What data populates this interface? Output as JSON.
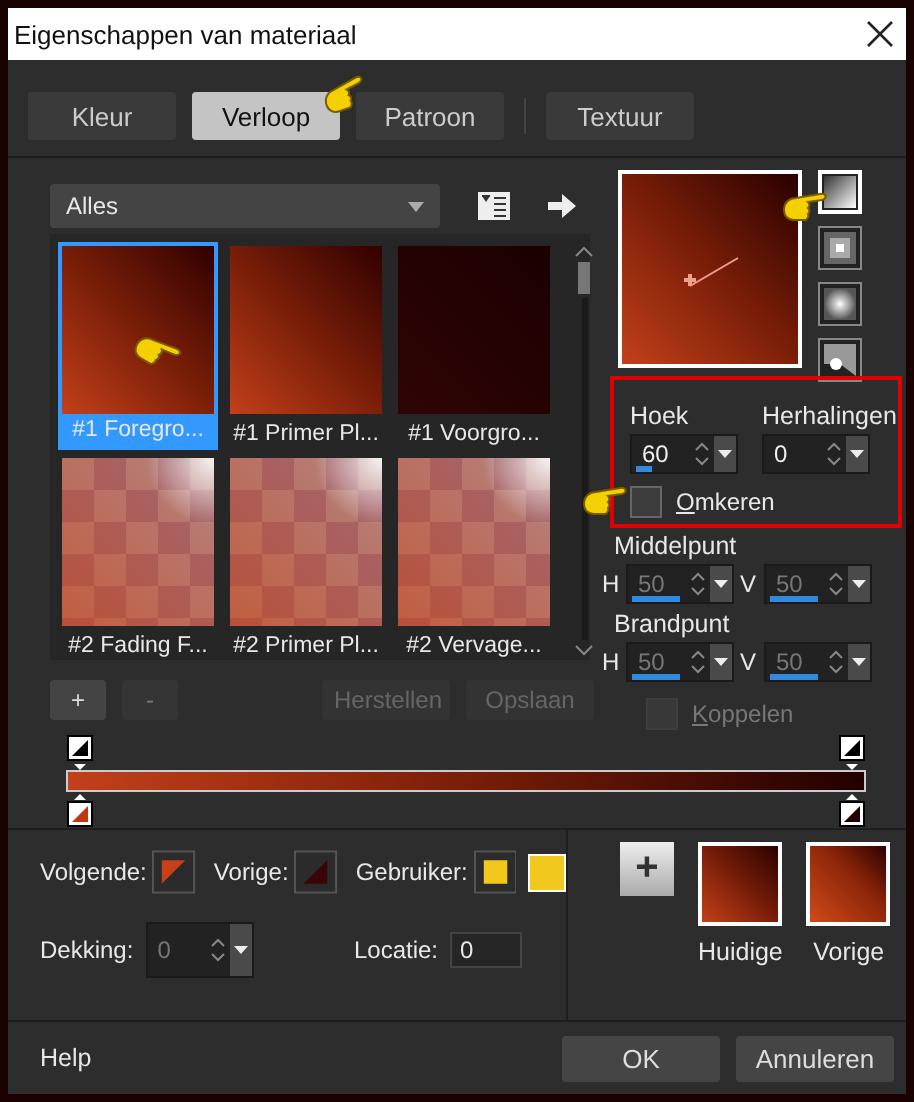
{
  "window": {
    "title": "Eigenschappen van materiaal"
  },
  "tabs": [
    {
      "label": "Kleur",
      "selected": false
    },
    {
      "label": "Verloop",
      "selected": true
    },
    {
      "label": "Patroon",
      "selected": false
    },
    {
      "label": "Textuur",
      "selected": false
    }
  ],
  "category": {
    "value": "Alles"
  },
  "gradients": [
    {
      "label": "#1 Foregro...",
      "kind": "warm",
      "selected": true
    },
    {
      "label": "#1 Primer Pl...",
      "kind": "warm",
      "selected": false
    },
    {
      "label": "#1 Voorgro...",
      "kind": "dark",
      "selected": false
    },
    {
      "label": "#2 Fading F...",
      "kind": "checker",
      "selected": false
    },
    {
      "label": "#2 Primer Pl...",
      "kind": "checker",
      "selected": false
    },
    {
      "label": "#2 Vervage...",
      "kind": "checker",
      "selected": false
    }
  ],
  "styles": [
    {
      "kind": "linear",
      "selected": true
    },
    {
      "kind": "rectangular",
      "selected": false
    },
    {
      "kind": "sunburst",
      "selected": false
    },
    {
      "kind": "radial",
      "selected": false
    }
  ],
  "angle": {
    "label": "Hoek",
    "value": "60",
    "level": 0.17,
    "disabled": false
  },
  "repeats": {
    "label": "Herhalingen",
    "value": "0",
    "disabled": false
  },
  "invert": {
    "label": "Omkeren",
    "checked": false,
    "disabled": false
  },
  "midpoint": {
    "label": "Middelpunt",
    "fields": [
      {
        "axis": "H",
        "value": "50",
        "level": 0.5,
        "disabled": true
      },
      {
        "axis": "V",
        "value": "50",
        "level": 0.5,
        "disabled": true
      }
    ]
  },
  "focal": {
    "label": "Brandpunt",
    "fields": [
      {
        "axis": "H",
        "value": "50",
        "level": 0.5,
        "disabled": true
      },
      {
        "axis": "V",
        "value": "50",
        "level": 0.5,
        "disabled": true
      }
    ]
  },
  "link": {
    "label": "Koppelen",
    "checked": false,
    "disabled": true
  },
  "stop_buttons": [
    {
      "label": "+",
      "disabled": false
    },
    {
      "label": "-",
      "disabled": true
    }
  ],
  "preset_buttons": [
    {
      "label": "Herstellen",
      "disabled": true
    },
    {
      "label": "Opslaan",
      "disabled": true
    }
  ],
  "stop_colors": [
    {
      "label": "Volgende:"
    },
    {
      "label": "Vorige:"
    },
    {
      "label": "Gebruiker:"
    }
  ],
  "opacity": {
    "label": "Dekking:",
    "value": "0",
    "disabled": true
  },
  "location": {
    "label": "Locatie:",
    "value": "0"
  },
  "swatches": {
    "add": "+",
    "items": [
      {
        "label": "Huidige"
      },
      {
        "label": "Vorige"
      }
    ]
  },
  "footer": {
    "help": "Help",
    "buttons": [
      {
        "label": "OK"
      },
      {
        "label": "Annuleren"
      }
    ]
  }
}
